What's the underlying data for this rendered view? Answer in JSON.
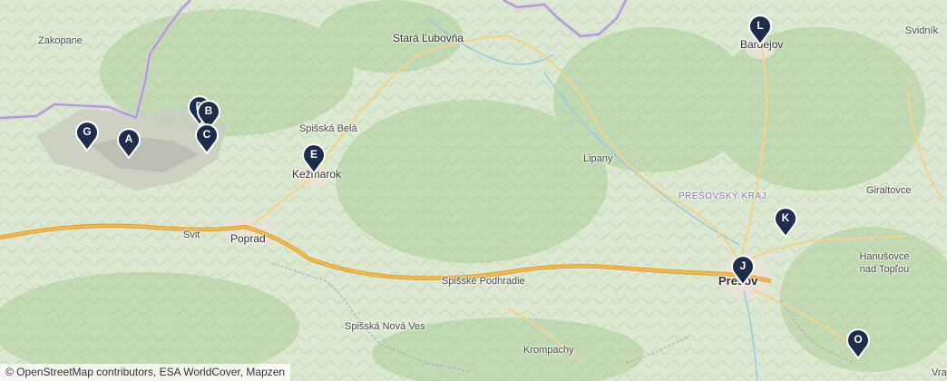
{
  "places": [
    {
      "id": "zakopane",
      "label": "Zakopane"
    },
    {
      "id": "stara-lubovna",
      "label": "Stará Ľubovňa"
    },
    {
      "id": "bardejov",
      "label": "Bardejov"
    },
    {
      "id": "svidnik",
      "label": "Svidník"
    },
    {
      "id": "spisska-bela",
      "label": "Spišská Belá"
    },
    {
      "id": "kezmarok",
      "label": "Kežmarok"
    },
    {
      "id": "lipany",
      "label": "Lipany"
    },
    {
      "id": "presovsky-kraj",
      "label": "PREŠOVSKÝ KRAJ"
    },
    {
      "id": "giraltovce",
      "label": "Giraltovce"
    },
    {
      "id": "svit",
      "label": "Svit"
    },
    {
      "id": "poprad",
      "label": "Poprad"
    },
    {
      "id": "hanusovce",
      "label": "Hanušovce nad Topľou"
    },
    {
      "id": "presov",
      "label": "Prešov"
    },
    {
      "id": "spisske-podhradie",
      "label": "Spišské Podhradie"
    },
    {
      "id": "spisska-nova-ves",
      "label": "Spišská Nová Ves"
    },
    {
      "id": "krompachy",
      "label": "Krompachy"
    },
    {
      "id": "vra",
      "label": "Vra"
    }
  ],
  "markers": [
    {
      "letter": "D"
    },
    {
      "letter": "B"
    },
    {
      "letter": "C"
    },
    {
      "letter": "G"
    },
    {
      "letter": "A"
    },
    {
      "letter": "E"
    },
    {
      "letter": "L"
    },
    {
      "letter": "K"
    },
    {
      "letter": "J"
    },
    {
      "letter": "O"
    }
  ],
  "attribution": "© OpenStreetMap contributors, ESA WorldCover, Mapzen",
  "colors": {
    "marker": "#1f2d4b",
    "road_motorway": "#f0b84a",
    "road_primary": "#f3d48a",
    "border": "#8a6bb0",
    "water": "#9fc7e6"
  }
}
